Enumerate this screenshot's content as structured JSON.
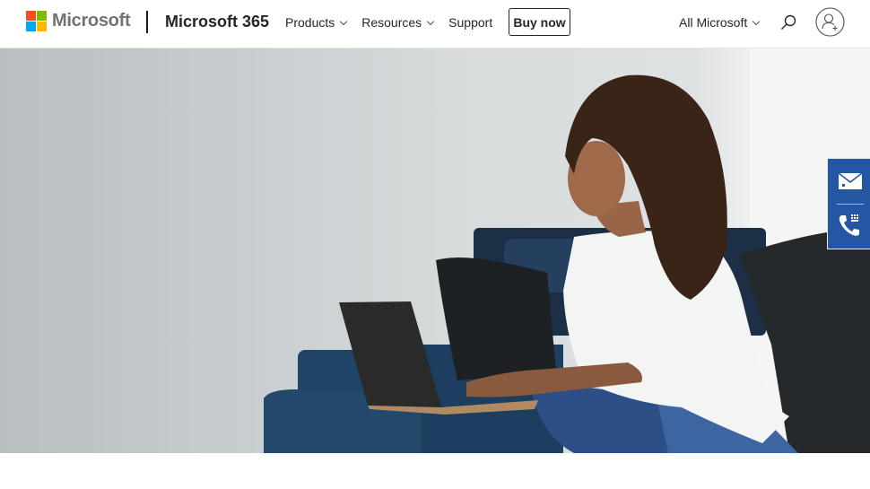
{
  "header": {
    "brand": "Microsoft",
    "product": "Microsoft 365",
    "nav": [
      {
        "label": "Products",
        "has_dropdown": true
      },
      {
        "label": "Resources",
        "has_dropdown": true
      },
      {
        "label": "Support",
        "has_dropdown": false
      }
    ],
    "buy_label": "Buy now",
    "all_microsoft_label": "All Microsoft",
    "icons": {
      "search": "search-icon",
      "account": "account-add-icon"
    }
  },
  "brand_colors": {
    "red": "#f25022",
    "green": "#7fba00",
    "blue": "#00a4ef",
    "yellow": "#ffb900"
  },
  "hero": {
    "image_description": "Woman with curly hair in white shirt typing on a laptop while sitting on a navy blue sofa"
  },
  "contact_widget": {
    "color": "#2456a4",
    "items": [
      {
        "icon": "mail-icon",
        "label": "Email"
      },
      {
        "icon": "phone-icon",
        "label": "Call"
      }
    ]
  }
}
